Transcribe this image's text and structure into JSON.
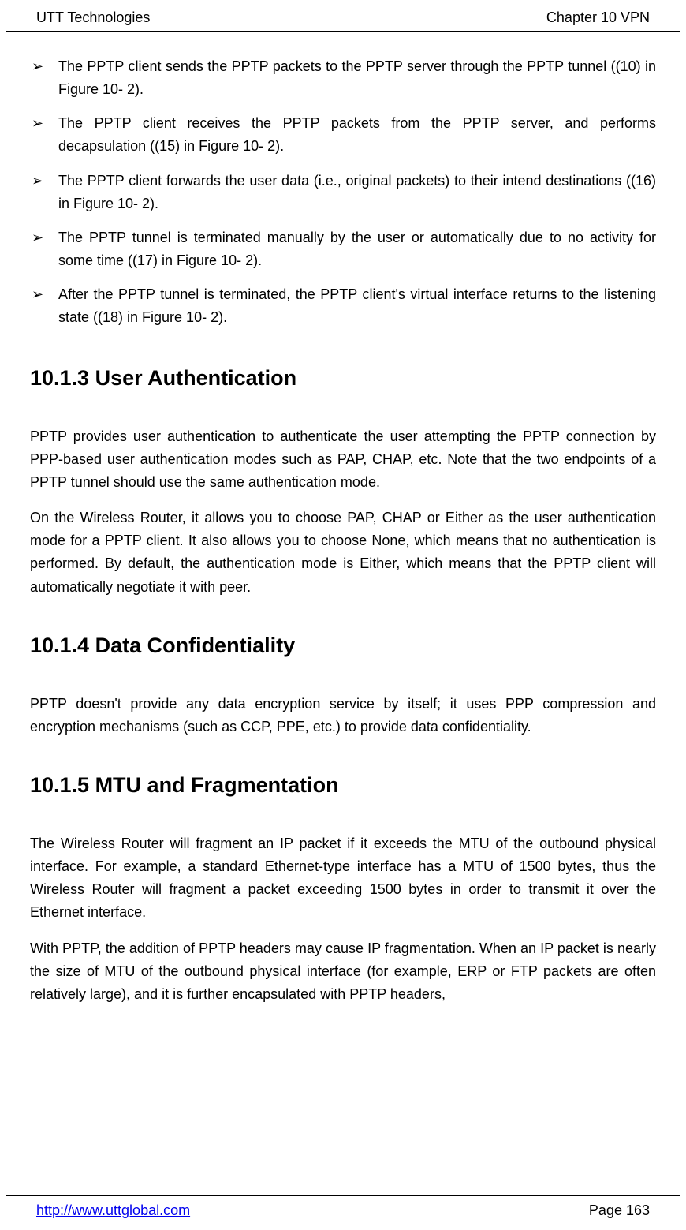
{
  "header": {
    "left": "UTT Technologies",
    "right": "Chapter 10 VPN"
  },
  "bullets": [
    "The PPTP client sends the PPTP packets to the PPTP server through the PPTP tunnel ((10) in Figure 10- 2).",
    "The PPTP client receives the PPTP packets from the PPTP server, and performs decapsulation ((15) in Figure 10- 2).",
    "The PPTP client forwards the user data (i.e., original packets) to their intend destinations ((16) in Figure 10- 2).",
    "The PPTP tunnel is terminated manually by the user or automatically due to no activity for some time ((17) in Figure 10- 2).",
    "After the PPTP tunnel is terminated, the PPTP client's virtual interface returns to the listening state ((18) in Figure 10- 2)."
  ],
  "sections": [
    {
      "heading": "10.1.3  User Authentication",
      "paras": [
        "PPTP provides user authentication to authenticate the user attempting the PPTP connection by PPP-based user authentication modes such as PAP, CHAP, etc. Note that the two endpoints of a PPTP tunnel should use the same authentication mode.",
        "On the Wireless Router, it allows you to choose PAP, CHAP or Either as the user authentication mode for a PPTP client. It also allows you to choose None, which means that no authentication is performed. By default, the authentication mode is Either, which means that the PPTP client will automatically negotiate it with peer."
      ]
    },
    {
      "heading": "10.1.4  Data Confidentiality",
      "paras": [
        "PPTP doesn't provide any data encryption service by itself; it uses PPP compression and encryption mechanisms (such as CCP, PPE, etc.) to provide data confidentiality."
      ]
    },
    {
      "heading": "10.1.5  MTU and Fragmentation",
      "paras": [
        "The Wireless Router will fragment an IP packet if it exceeds the MTU of the outbound physical interface. For example, a standard Ethernet-type interface has a MTU of 1500 bytes, thus the Wireless Router will fragment a packet exceeding 1500 bytes in order to transmit it over the Ethernet interface.",
        "With PPTP, the addition of PPTP headers may cause IP fragmentation. When an IP packet is nearly the size of MTU of the outbound physical interface (for example, ERP or FTP packets are often relatively large), and it is further encapsulated with PPTP headers,"
      ]
    }
  ],
  "footer": {
    "link": "http://www.uttglobal.com",
    "page": "Page 163"
  },
  "bullet_glyph": "➢"
}
